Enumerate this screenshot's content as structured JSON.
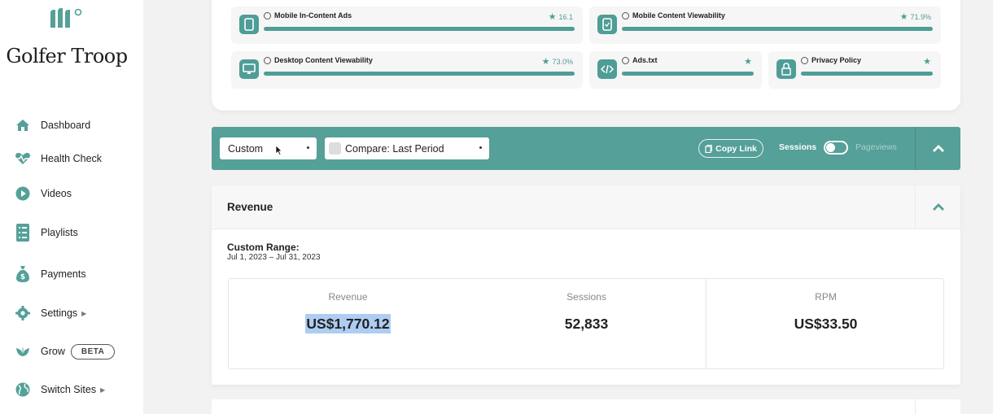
{
  "brand": {
    "site_name": "Golfer Troop",
    "accent": "#55a098"
  },
  "sidebar": {
    "items": [
      {
        "label": "Dashboard",
        "icon": "home-icon"
      },
      {
        "label": "Health Check",
        "icon": "heartbeat-icon"
      },
      {
        "label": "Videos",
        "icon": "play-circle-icon"
      },
      {
        "label": "Playlists",
        "icon": "list-icon"
      },
      {
        "label": "Payments",
        "icon": "money-bag-icon"
      },
      {
        "label": "Settings",
        "icon": "gear-icon"
      },
      {
        "label": "Grow",
        "icon": "sprout-icon",
        "badge": "BETA"
      },
      {
        "label": "Switch Sites",
        "icon": "globe-icon"
      }
    ]
  },
  "health_metrics": [
    {
      "label": "Mobile In-Content Ads",
      "score": "16.1",
      "icon": "mobile-icon"
    },
    {
      "label": "Mobile Content Viewability",
      "score": "71.9%",
      "icon": "mobile-check-icon"
    },
    {
      "label": "Desktop Content Viewability",
      "score": "73.0%",
      "icon": "desktop-icon"
    },
    {
      "label": "Ads.txt",
      "score": "",
      "icon": "code-icon"
    },
    {
      "label": "Privacy Policy",
      "score": "",
      "icon": "lock-icon"
    }
  ],
  "filters": {
    "range_value": "Custom",
    "compare_value": "Compare: Last Period",
    "copy_link": "Copy Link",
    "toggle_left": "Sessions",
    "toggle_right": "Pageviews"
  },
  "revenue": {
    "title": "Revenue",
    "range_label": "Custom Range:",
    "range_dates": "Jul 1, 2023 – Jul 31, 2023",
    "stats": [
      {
        "label": "Revenue",
        "value": "US$1,770.12"
      },
      {
        "label": "Sessions",
        "value": "52,833"
      },
      {
        "label": "RPM",
        "value": "US$33.50"
      }
    ]
  }
}
